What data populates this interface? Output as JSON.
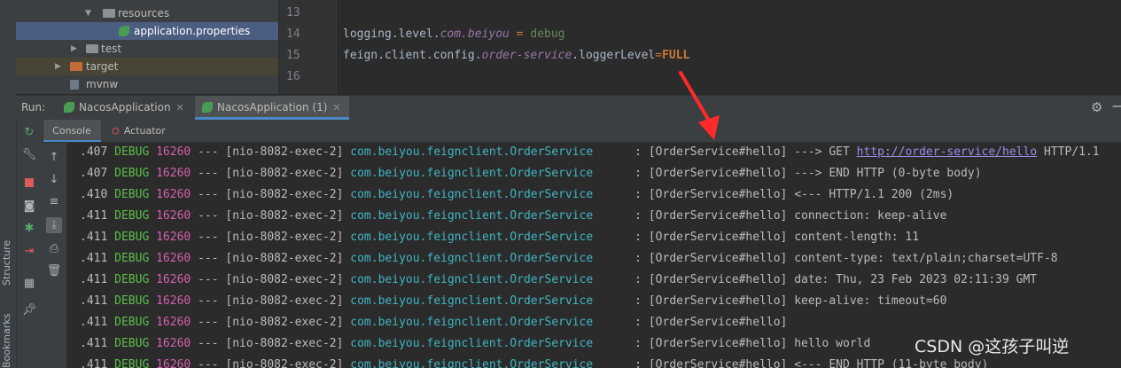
{
  "sidebar": {
    "structure_label": "Structure",
    "bookmarks_label": "Bookmarks"
  },
  "project_tree": [
    {
      "label": "resources",
      "type": "folder",
      "expanded": true
    },
    {
      "label": "application.properties",
      "type": "properties-file",
      "selected": true
    },
    {
      "label": "test",
      "type": "folder",
      "expanded": false
    },
    {
      "label": "target",
      "type": "folder-excluded",
      "expanded": false
    },
    {
      "label": "mvnw",
      "type": "file"
    }
  ],
  "editor": {
    "line_numbers": [
      "13",
      "14",
      "15",
      "16"
    ],
    "line14": {
      "key1": "logging.level.",
      "key2": "com.beiyou",
      "op": " = ",
      "value": "debug"
    },
    "line15": {
      "key1": "feign.client.config.",
      "key2": "order-service",
      "key3": ".loggerLevel",
      "op": "=",
      "value": "FULL"
    }
  },
  "run": {
    "label": "Run:",
    "tabs": [
      {
        "label": "NacosApplication"
      },
      {
        "label": "NacosApplication (1)"
      }
    ]
  },
  "console_tabs": {
    "console": "Console",
    "actuator": "Actuator"
  },
  "log": {
    "level": "DEBUG",
    "pid": "16260",
    "sep": "---",
    "thread": "[nio-8082-exec-2]",
    "logger": "com.beiyou.feignclient.OrderService",
    "lines": [
      {
        "time": ".407",
        "msg": "[OrderService#hello] ---> GET ",
        "url": "http://order-service/hello",
        "tail": " HTTP/1.1"
      },
      {
        "time": ".407",
        "msg": "[OrderService#hello] ---> END HTTP (0-byte body)"
      },
      {
        "time": ".410",
        "msg": "[OrderService#hello] <--- HTTP/1.1 200 (2ms)"
      },
      {
        "time": ".411",
        "msg": "[OrderService#hello] connection: keep-alive"
      },
      {
        "time": ".411",
        "msg": "[OrderService#hello] content-length: 11"
      },
      {
        "time": ".411",
        "msg": "[OrderService#hello] content-type: text/plain;charset=UTF-8"
      },
      {
        "time": ".411",
        "msg": "[OrderService#hello] date: Thu, 23 Feb 2023 02:11:39 GMT"
      },
      {
        "time": ".411",
        "msg": "[OrderService#hello] keep-alive: timeout=60"
      },
      {
        "time": ".411",
        "msg": "[OrderService#hello]"
      },
      {
        "time": ".411",
        "msg": "[OrderService#hello] hello world"
      },
      {
        "time": ".411",
        "msg": "[OrderService#hello] <--- END HTTP (11-byte body)"
      }
    ]
  },
  "watermark": "CSDN @这孩子叫逆",
  "colors": {
    "accent": "#4a88c7",
    "arrow": "#ff2a2a",
    "debug": "#5bbf49",
    "pid": "#d75fb3",
    "logger": "#3fb5c2"
  },
  "icons": {
    "rerun": "rerun-icon",
    "tool": "wrench-icon",
    "stop": "stop-icon",
    "camera": "camera-icon",
    "bug": "bug-icon",
    "exit": "exit-icon",
    "layout": "layout-icon",
    "pin": "pin-icon",
    "up": "arrow-up-icon",
    "down": "arrow-down-icon",
    "wrap": "soft-wrap-icon",
    "scroll": "scroll-to-end-icon",
    "print": "print-icon",
    "trash": "trash-icon"
  }
}
